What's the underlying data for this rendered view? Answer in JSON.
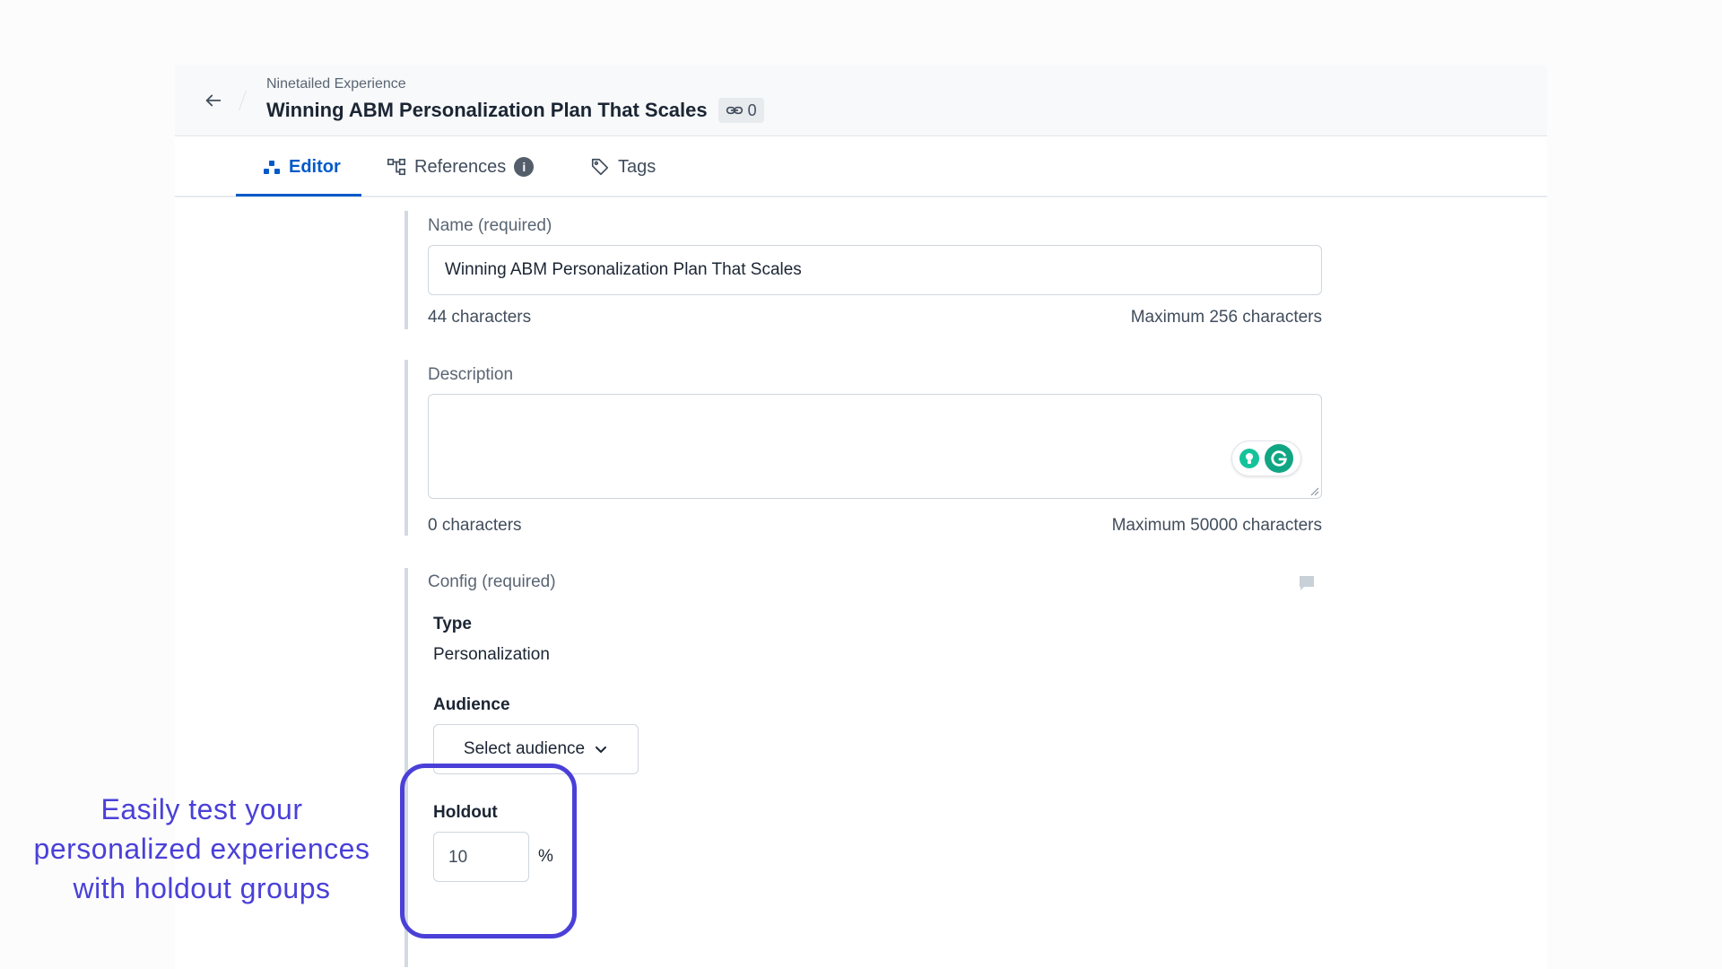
{
  "header": {
    "entry_type": "Ninetailed Experience",
    "title": "Winning ABM Personalization Plan That Scales",
    "reference_count": "0"
  },
  "tabs": [
    {
      "label": "Editor",
      "active": true
    },
    {
      "label": "References",
      "badge": "i"
    },
    {
      "label": "Tags"
    }
  ],
  "fields": {
    "name": {
      "label": "Name (required)",
      "value": "Winning ABM Personalization Plan That Scales",
      "count": "44 characters",
      "max": "Maximum 256 characters"
    },
    "description": {
      "label": "Description",
      "value": "",
      "count": "0 characters",
      "max": "Maximum 50000 characters"
    },
    "config": {
      "label": "Config (required)",
      "type_label": "Type",
      "type_value": "Personalization",
      "audience_label": "Audience",
      "audience_select": "Select audience",
      "holdout_label": "Holdout",
      "holdout_value": "10",
      "holdout_unit": "%"
    }
  },
  "annotation": "Easily test your personalized experiences with holdout groups",
  "colors": {
    "accent": "#0059c8",
    "highlight": "#4a40d8",
    "grammarly": "#11a683"
  }
}
